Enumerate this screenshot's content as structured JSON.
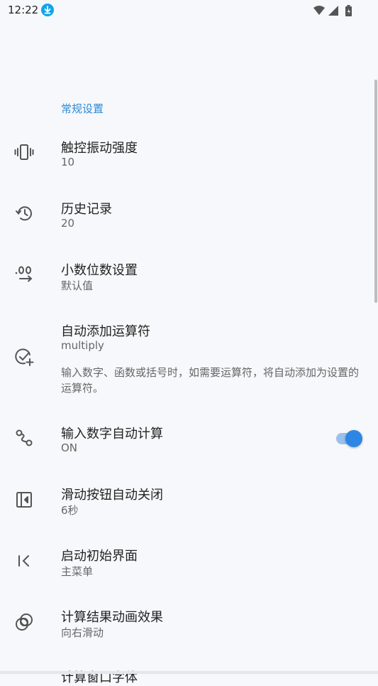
{
  "status_bar": {
    "time": "12:22",
    "icons": [
      "download-icon",
      "wifi-icon",
      "signal-icon",
      "battery-icon"
    ]
  },
  "section": {
    "title": "常规设置"
  },
  "settings": [
    {
      "icon": "vibration-icon",
      "title": "触控振动强度",
      "value": "10"
    },
    {
      "icon": "history-icon",
      "title": "历史记录",
      "value": "20"
    },
    {
      "icon": "decimal-places-icon",
      "title": "小数位数设置",
      "value": "默认值"
    },
    {
      "icon": "add-check-icon",
      "title": "自动添加运算符",
      "value": "multiply",
      "description": "输入数字、函数或括号时，如需要运算符，将自动添加为设置的运算符。"
    },
    {
      "icon": "auto-calc-icon",
      "title": "输入数字自动计算",
      "value": "ON",
      "toggle_on": true
    },
    {
      "icon": "sidebar-close-icon",
      "title": "滑动按钮自动关闭",
      "value": "6秒"
    },
    {
      "icon": "start-screen-icon",
      "title": "启动初始界面",
      "value": "主菜单"
    },
    {
      "icon": "animation-icon",
      "title": "计算结果动画效果",
      "value": "向右滑动"
    },
    {
      "icon": "",
      "title": "计算窗口字体",
      "value": ""
    }
  ],
  "colors": {
    "accent": "#2a8ad8",
    "toggle_on": "#2d86e3",
    "background": "#f7f8fb"
  }
}
